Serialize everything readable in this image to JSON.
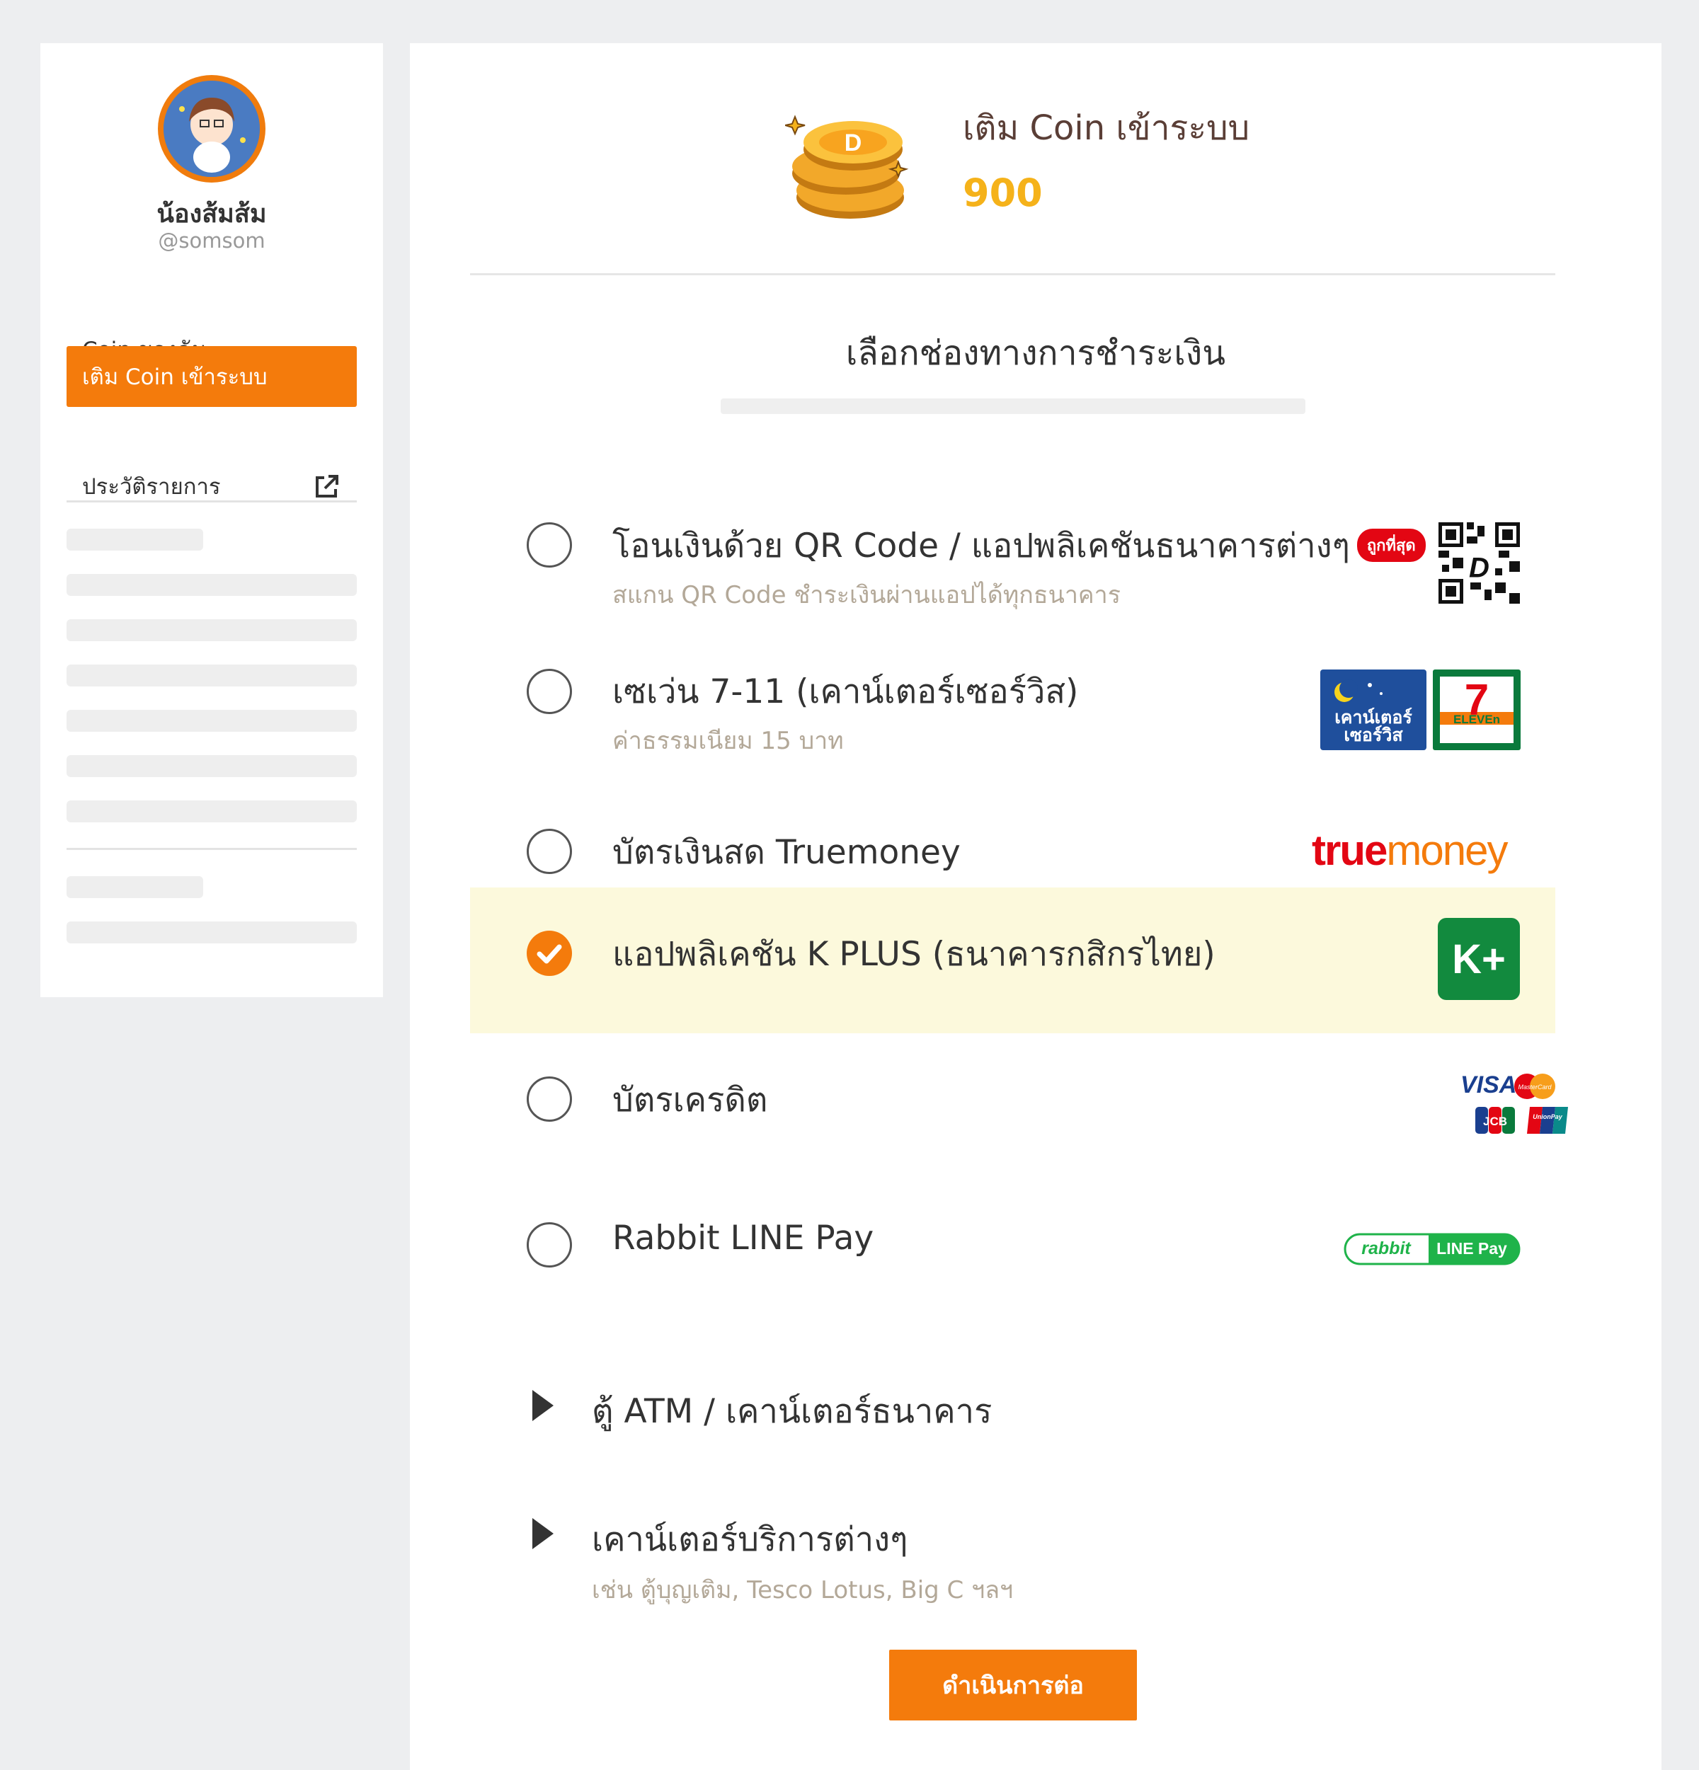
{
  "sidebar": {
    "user_name": "น้องส้มส้ม",
    "user_handle": "@somsom",
    "menu": [
      {
        "label": "Coin ของฉัน",
        "active": false
      },
      {
        "label": "เติม Coin เข้าระบบ",
        "active": true
      },
      {
        "label": "ประวัติรายการ",
        "active": false,
        "icon": "external-link-icon"
      }
    ]
  },
  "header": {
    "title": "เติม Coin เข้าระบบ",
    "amount": "900"
  },
  "payment": {
    "section_title": "เลือกช่องทางการชำระเงิน",
    "options": [
      {
        "title": "โอนเงินด้วย QR Code / แอปพลิเคชันธนาคารต่างๆ",
        "badge": "ถูกที่สุด",
        "subtitle": "สแกน QR Code ชำระเงินผ่านแอปได้ทุกธนาคาร",
        "logo": "qr-code-icon",
        "selected": false
      },
      {
        "title": "เซเว่น 7-11 (เคาน์เตอร์เซอร์วิส)",
        "subtitle": "ค่าธรรมเนียม 15 บาท",
        "logo": "counter-service-7eleven-logo",
        "selected": false,
        "logo_text": {
          "cs_line1": "เคาน์เตอร์",
          "cs_line2": "เซอร์วิส",
          "seven": "7",
          "eleven": "ELEVEn"
        }
      },
      {
        "title": "บัตรเงินสด Truemoney",
        "logo": "truemoney-logo",
        "selected": false,
        "logo_text": {
          "true": "true",
          "money": "money"
        }
      },
      {
        "title": "แอปพลิเคชัน K PLUS (ธนาคารกสิกรไทย)",
        "logo": "kplus-logo",
        "selected": true,
        "logo_text": "K+"
      },
      {
        "title": "บัตรเครดิต",
        "logo": "credit-card-logos",
        "selected": false,
        "logo_text": {
          "visa": "VISA",
          "mastercard": "MasterCard",
          "jcb": "JCB",
          "unionpay": "UnionPay"
        }
      },
      {
        "title": "Rabbit LINE Pay",
        "logo": "rabbit-line-pay-logo",
        "selected": false,
        "logo_text": {
          "rabbit": "rabbit",
          "linepay": "LINE Pay"
        }
      }
    ],
    "expanders": [
      {
        "title": "ตู้ ATM / เคาน์เตอร์ธนาคาร"
      },
      {
        "title": "เคาน์เตอร์บริการต่างๆ",
        "subtitle": "เช่น ตู้บุญเติม, Tesco Lotus, Big C ฯลฯ"
      }
    ],
    "proceed_label": "ดำเนินการต่อ"
  },
  "colors": {
    "accent": "#f47b0c",
    "coin": "#f5b21a",
    "selected_bg": "#fcf9dc"
  }
}
